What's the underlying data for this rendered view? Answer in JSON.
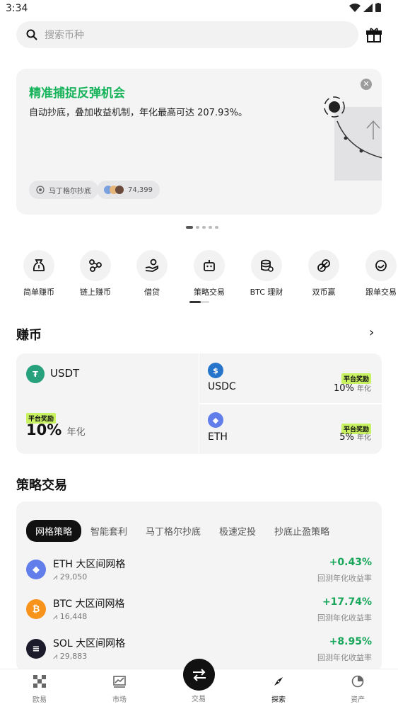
{
  "status": {
    "time": "3:34"
  },
  "search": {
    "placeholder": "搜索币种"
  },
  "banner": {
    "title": "精准捕捉反弹机会",
    "subtitle": "自动抄底，叠加收益机制，年化最高可达 207.93%。",
    "chip_strategy": "马丁格尔抄底",
    "chip_count": "74,399"
  },
  "features": [
    {
      "label": "简单赚币"
    },
    {
      "label": "链上赚币"
    },
    {
      "label": "借贷"
    },
    {
      "label": "策略交易"
    },
    {
      "label": "BTC 理财"
    },
    {
      "label": "双币赢"
    },
    {
      "label": "跟单交易"
    }
  ],
  "earn": {
    "title": "赚币",
    "usdt": {
      "name": "USDT",
      "tag": "平台奖励",
      "rate": "10%",
      "unit": "年化"
    },
    "usdc": {
      "name": "USDC",
      "tag": "平台奖励",
      "rate": "10%",
      "unit": "年化"
    },
    "eth": {
      "name": "ETH",
      "tag": "平台奖励",
      "rate": "5%",
      "unit": "年化"
    }
  },
  "strategy": {
    "title": "策略交易",
    "tabs": [
      "网格策略",
      "智能套利",
      "马丁格尔抄底",
      "极速定投",
      "抄底止盈策略"
    ],
    "rows": [
      {
        "name": "ETH 大区间网格",
        "count": "29,050",
        "pct": "+0.43%",
        "pct_label": "回测年化收益率",
        "color": "#627eea"
      },
      {
        "name": "BTC 大区间网格",
        "count": "16,448",
        "pct": "+17.74%",
        "pct_label": "回测年化收益率",
        "color": "#f7931a"
      },
      {
        "name": "SOL 大区间网格",
        "count": "29,883",
        "pct": "+8.95%",
        "pct_label": "回测年化收益率",
        "color": "#1b1b2b"
      }
    ]
  },
  "nav": {
    "items": [
      "欧易",
      "市场",
      "交易",
      "探索",
      "资产"
    ],
    "active": "探索"
  },
  "colors": {
    "accent_green": "#16b35a",
    "tag_lime": "#c8f261"
  }
}
